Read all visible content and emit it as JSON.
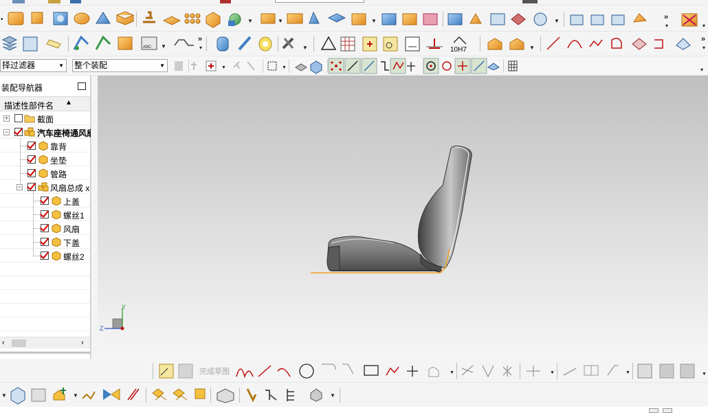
{
  "selection_filter": {
    "value": "择过滤器"
  },
  "assembly_scope": {
    "value": "整个装配"
  },
  "navigator": {
    "title": "装配导航器",
    "column_header": "描述性部件名",
    "items": [
      {
        "label": "截面",
        "checked": false,
        "icon": "folder-icon"
      },
      {
        "label": "汽车座椅通风扇",
        "checked": true,
        "icon": "assembly-icon"
      },
      {
        "label": "靠背",
        "checked": true,
        "icon": "part-icon"
      },
      {
        "label": "坐垫",
        "checked": true,
        "icon": "part-icon"
      },
      {
        "label": "管路",
        "checked": true,
        "icon": "part-icon"
      },
      {
        "label": "风扇总成 x",
        "checked": true,
        "icon": "assembly-icon"
      },
      {
        "label": "上盖",
        "checked": true,
        "icon": "part-icon"
      },
      {
        "label": "螺丝1",
        "checked": true,
        "icon": "part-icon"
      },
      {
        "label": "风扇",
        "checked": true,
        "icon": "part-icon"
      },
      {
        "label": "下盖",
        "checked": true,
        "icon": "part-icon"
      },
      {
        "label": "螺丝2",
        "checked": true,
        "icon": "part-icon"
      }
    ]
  },
  "sketch_toolbar": {
    "finish_sketch": "完成草图"
  },
  "toolbar_text": {
    "fit_tolerance": "10H7"
  },
  "triad": {
    "y": "Y",
    "z": "Z"
  },
  "colors": {
    "accent_orange": "#f0a020",
    "check_red": "#d10000",
    "viewport_top": "#bfbfbf",
    "viewport_bottom": "#f6f6f6"
  }
}
